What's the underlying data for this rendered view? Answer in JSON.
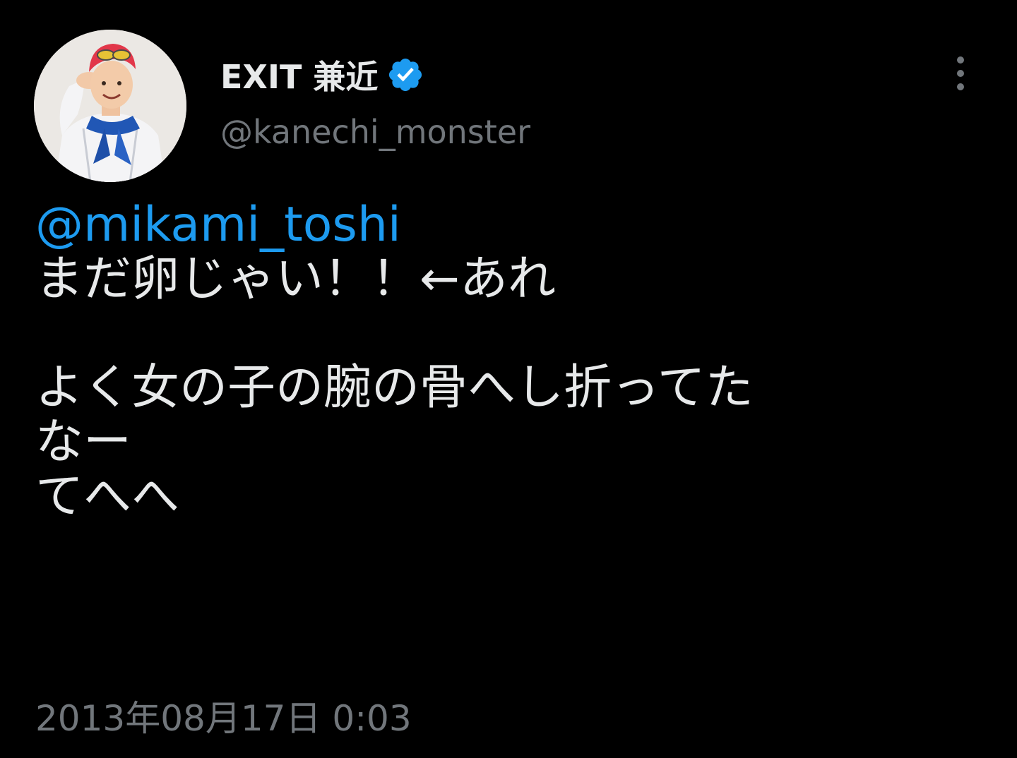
{
  "tweet": {
    "author": {
      "display_name": "EXIT 兼近",
      "handle": "@kanechi_monster",
      "verified_icon": "verified-badge-icon",
      "avatar": "profile-avatar-image"
    },
    "more_icon": "more-vertical-icon",
    "body": {
      "mention": "@mikami_toshi",
      "line1": "まだ卵じゃい！！←あれ",
      "line2": "よく女の子の腕の骨へし折ってた",
      "line3": "なー",
      "line4": "てへへ"
    },
    "timestamp": "2013年08月17日 0:03"
  },
  "colors": {
    "background": "#000000",
    "primary_text": "#e7e9ea",
    "secondary_text": "#71767b",
    "accent_blue": "#1d9bf0"
  }
}
